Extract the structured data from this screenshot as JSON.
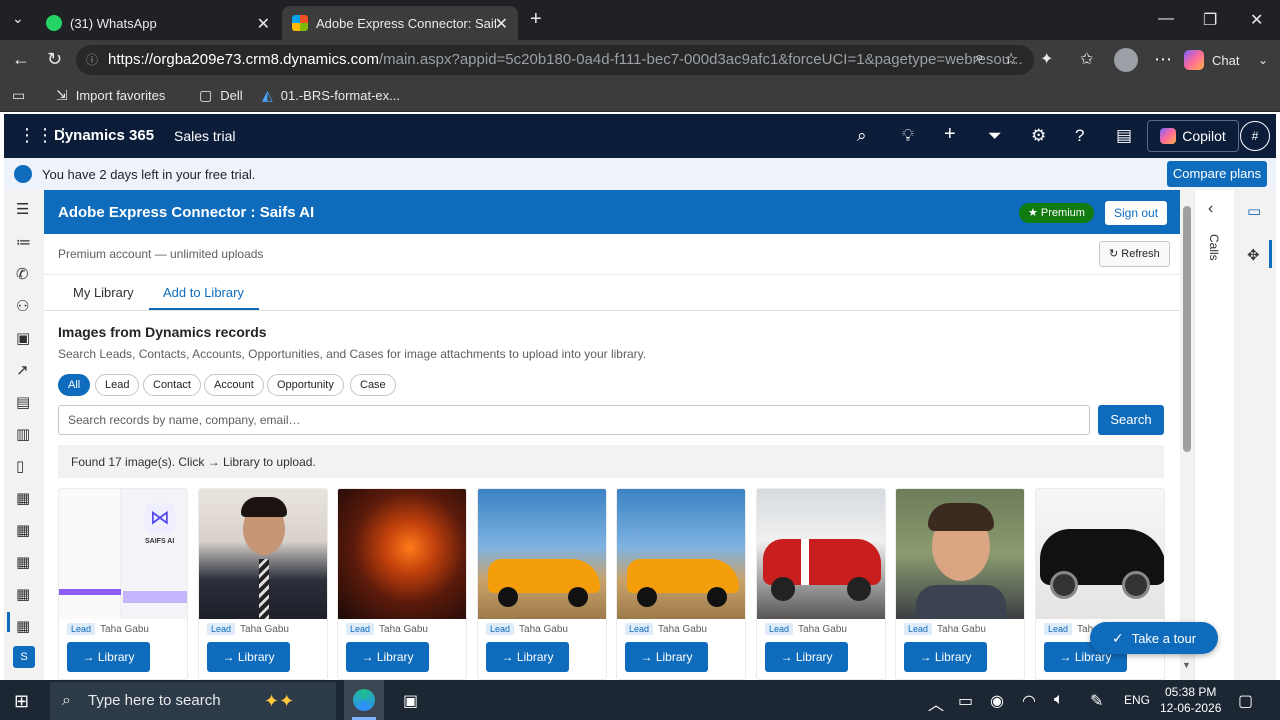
{
  "browser": {
    "tabs": [
      {
        "label": "(31) WhatsApp",
        "icon": "whatsapp-icon"
      },
      {
        "label": "Adobe Express Connector: Saifs AI",
        "icon": "microsoft-icon"
      }
    ],
    "url_host": "https://orgba209e73.crm8.dynamics.com",
    "url_rest": "/main.aspx?appid=5c20b180-0a4d-f111-bec7-000d3ac9afc1&forceUCI=1&pagetype=webresou...",
    "chat_label": "Chat",
    "bookmarks": [
      "Import favorites",
      "Dell",
      "01.-BRS-format-ex..."
    ]
  },
  "dynamics": {
    "title": "Dynamics 365",
    "app": "Sales trial",
    "copilot": "Copilot",
    "hash": "#",
    "trial_msg": "You have 2 days left in your free trial.",
    "compare": "Compare plans",
    "user_initial": "S"
  },
  "app": {
    "title": "Adobe Express Connector : Saifs AI",
    "premium": "★ Premium",
    "signout": "Sign out",
    "account": "Premium account — unlimited uploads",
    "refresh": "↻ Refresh",
    "tabs": [
      "My Library",
      "Add to Library"
    ],
    "section_title": "Images from Dynamics records",
    "section_desc": "Search Leads, Contacts, Accounts, Opportunities, and Cases for image attachments to upload into your library.",
    "filters": [
      "All",
      "Lead",
      "Contact",
      "Account",
      "Opportunity",
      "Case"
    ],
    "search_placeholder": "Search records by name, company, email…",
    "search_btn": "Search",
    "found": "Found 17 image(s). Click → Library to upload.",
    "cards": [
      {
        "tag": "Lead",
        "owner": "Taha Gabu",
        "btn": "→ Library"
      },
      {
        "tag": "Lead",
        "owner": "Taha Gabu",
        "btn": "→ Library"
      },
      {
        "tag": "Lead",
        "owner": "Taha Gabu",
        "btn": "→ Library"
      },
      {
        "tag": "Lead",
        "owner": "Taha Gabu",
        "btn": "→ Library"
      },
      {
        "tag": "Lead",
        "owner": "Taha Gabu",
        "btn": "→ Library"
      },
      {
        "tag": "Lead",
        "owner": "Taha Gabu",
        "btn": "→ Library"
      },
      {
        "tag": "Lead",
        "owner": "Taha Gabu",
        "btn": "→ Library"
      },
      {
        "tag": "Lead",
        "owner": "Taha Gabu",
        "btn": "→ Library"
      }
    ],
    "card1_text": "SAIFS AI",
    "side_calls": "Calls",
    "tour": "Take a tour"
  },
  "taskbar": {
    "search": "Type here to search",
    "lang": "ENG",
    "time": "05:38 PM",
    "date": "12-06-2026"
  }
}
